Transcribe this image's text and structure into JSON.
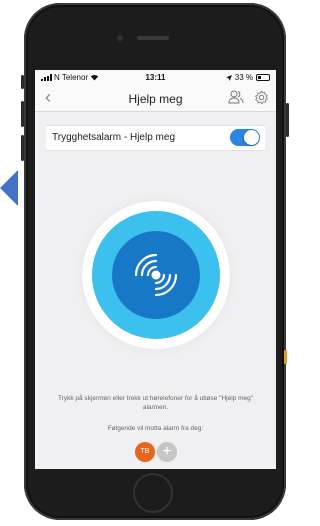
{
  "status_bar": {
    "carrier": "N Telenor",
    "time": "13:11",
    "battery_text": "33 %",
    "battery_level": 0.33
  },
  "nav": {
    "back_symbol": "‹",
    "title": "Hjelp meg",
    "icons": [
      "contacts-icon",
      "settings-gear-icon"
    ]
  },
  "toggle_row": {
    "label": "Trygghetsalarm - Hjelp meg",
    "enabled": true
  },
  "alarm": {
    "icon": "alarm-signal-icon"
  },
  "instruction_text": "Trykk på skjermen eller trekk ut hørelefoner for å utløse \"Hjelp meg\" alarmen.",
  "recipients": {
    "label": "Følgende vil motta alarm fra deg:",
    "contacts": [
      {
        "initials": "TB",
        "color": "#e8651e"
      }
    ],
    "add_symbol": "+"
  },
  "colors": {
    "accent_blue": "#1e93dc",
    "ring_light_blue": "#3cc0ee",
    "inner_blue": "#1878c8",
    "toggle_blue": "#2b86e0",
    "arrow_blue": "#4472c4"
  }
}
